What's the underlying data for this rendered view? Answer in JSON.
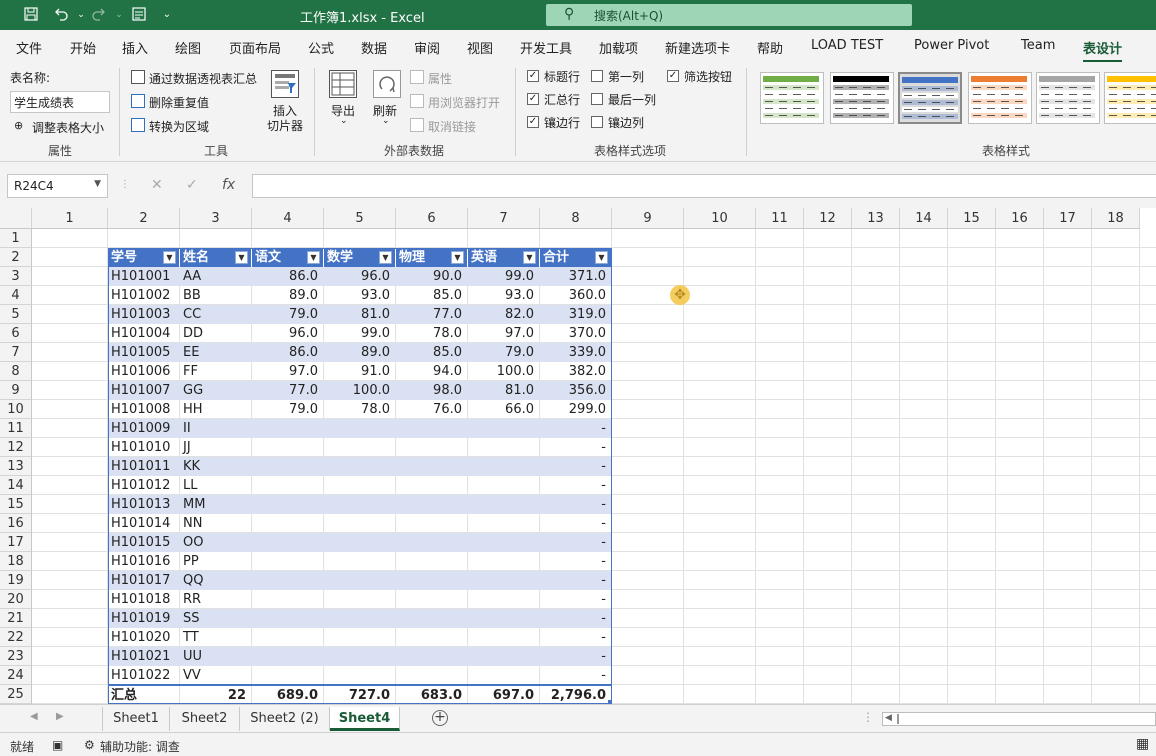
{
  "window": {
    "title": "工作簿1.xlsx  -  Excel",
    "search_placeholder": "搜索(Alt+Q)"
  },
  "menu_tabs": [
    "文件",
    "开始",
    "插入",
    "绘图",
    "页面布局",
    "公式",
    "数据",
    "审阅",
    "视图",
    "开发工具",
    "加载项",
    "新建选项卡",
    "帮助",
    "LOAD TEST",
    "Power Pivot",
    "Team",
    "表设计"
  ],
  "active_tab": "表设计",
  "ribbon": {
    "properties": {
      "table_name_label": "表名称:",
      "table_name_value": "学生成绩表",
      "resize_label": "调整表格大小",
      "group_label": "属性"
    },
    "tools": {
      "pivot_label": "通过数据透视表汇总",
      "remove_dup_label": "删除重复值",
      "convert_label": "转换为区域",
      "slicer_label": "插入\n切片器",
      "slicer_line1": "插入",
      "slicer_line2": "切片器",
      "group_label": "工具"
    },
    "external": {
      "export_label": "导出",
      "refresh_label": "刷新",
      "properties_label": "属性",
      "open_browser_label": "用浏览器打开",
      "unlink_label": "取消链接",
      "group_label": "外部表数据"
    },
    "style_options": {
      "header_row": {
        "label": "标题行",
        "checked": true
      },
      "total_row": {
        "label": "汇总行",
        "checked": true
      },
      "banded_rows": {
        "label": "镶边行",
        "checked": true
      },
      "first_column": {
        "label": "第一列",
        "checked": false
      },
      "last_column": {
        "label": "最后一列",
        "checked": false
      },
      "banded_columns": {
        "label": "镶边列",
        "checked": false
      },
      "filter_button": {
        "label": "筛选按钮",
        "checked": true
      },
      "group_label": "表格样式选项"
    },
    "table_styles": {
      "group_label": "表格样式",
      "swatches": [
        {
          "name": "green",
          "color": "#70ad47"
        },
        {
          "name": "black",
          "color": "#000000"
        },
        {
          "name": "blue",
          "color": "#4472c4",
          "selected": true
        },
        {
          "name": "orange",
          "color": "#ed7d31"
        },
        {
          "name": "gray",
          "color": "#a5a5a5"
        },
        {
          "name": "gold",
          "color": "#ffc000"
        }
      ]
    }
  },
  "formula_bar": {
    "name_box": "R24C4",
    "formula": ""
  },
  "columns": [
    "1",
    "2",
    "3",
    "4",
    "5",
    "6",
    "7",
    "8",
    "9",
    "10",
    "11",
    "12",
    "13",
    "14",
    "15",
    "16",
    "17",
    "18"
  ],
  "rows": [
    "1",
    "2",
    "3",
    "4",
    "5",
    "6",
    "7",
    "8",
    "9",
    "10",
    "11",
    "12",
    "13",
    "14",
    "15",
    "16",
    "17",
    "18",
    "19",
    "20",
    "21",
    "22",
    "23",
    "24",
    "25"
  ],
  "table": {
    "headers": [
      "学号",
      "姓名",
      "语文",
      "数学",
      "物理",
      "英语",
      "合计"
    ],
    "rows": [
      [
        "H101001",
        "AA",
        "86.0",
        "96.0",
        "90.0",
        "99.0",
        "371.0"
      ],
      [
        "H101002",
        "BB",
        "89.0",
        "93.0",
        "85.0",
        "93.0",
        "360.0"
      ],
      [
        "H101003",
        "CC",
        "79.0",
        "81.0",
        "77.0",
        "82.0",
        "319.0"
      ],
      [
        "H101004",
        "DD",
        "96.0",
        "99.0",
        "78.0",
        "97.0",
        "370.0"
      ],
      [
        "H101005",
        "EE",
        "86.0",
        "89.0",
        "85.0",
        "79.0",
        "339.0"
      ],
      [
        "H101006",
        "FF",
        "97.0",
        "91.0",
        "94.0",
        "100.0",
        "382.0"
      ],
      [
        "H101007",
        "GG",
        "77.0",
        "100.0",
        "98.0",
        "81.0",
        "356.0"
      ],
      [
        "H101008",
        "HH",
        "79.0",
        "78.0",
        "76.0",
        "66.0",
        "299.0"
      ],
      [
        "H101009",
        "II",
        "",
        "",
        "",
        "",
        "-"
      ],
      [
        "H101010",
        "JJ",
        "",
        "",
        "",
        "",
        "-"
      ],
      [
        "H101011",
        "KK",
        "",
        "",
        "",
        "",
        "-"
      ],
      [
        "H101012",
        "LL",
        "",
        "",
        "",
        "",
        "-"
      ],
      [
        "H101013",
        "MM",
        "",
        "",
        "",
        "",
        "-"
      ],
      [
        "H101014",
        "NN",
        "",
        "",
        "",
        "",
        "-"
      ],
      [
        "H101015",
        "OO",
        "",
        "",
        "",
        "",
        "-"
      ],
      [
        "H101016",
        "PP",
        "",
        "",
        "",
        "",
        "-"
      ],
      [
        "H101017",
        "QQ",
        "",
        "",
        "",
        "",
        "-"
      ],
      [
        "H101018",
        "RR",
        "",
        "",
        "",
        "",
        "-"
      ],
      [
        "H101019",
        "SS",
        "",
        "",
        "",
        "",
        "-"
      ],
      [
        "H101020",
        "TT",
        "",
        "",
        "",
        "",
        "-"
      ],
      [
        "H101021",
        "UU",
        "",
        "",
        "",
        "",
        "-"
      ],
      [
        "H101022",
        "VV",
        "",
        "",
        "",
        "",
        "-"
      ]
    ],
    "total_row": [
      "汇总",
      "22",
      "689.0",
      "727.0",
      "683.0",
      "697.0",
      "2,796.0"
    ],
    "header_color": "#4472c4",
    "band_color": "#d9e1f2"
  },
  "sheets": [
    "Sheet1",
    "Sheet2",
    "Sheet2 (2)",
    "Sheet4"
  ],
  "active_sheet": "Sheet4",
  "status": {
    "mode": "就绪",
    "accessibility": "辅助功能: 调查"
  },
  "colors": {
    "excel_green": "#217346",
    "accent_green": "#185c37"
  }
}
